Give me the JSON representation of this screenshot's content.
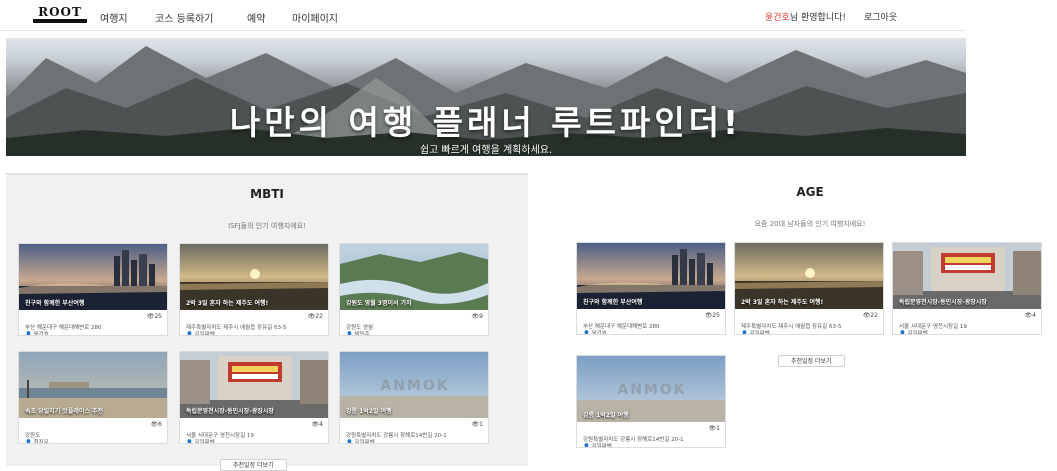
{
  "nav": {
    "logo": "ROOT",
    "logo_sub": "FINDER",
    "items": [
      "여행지",
      "코스 등록하기",
      "예약",
      "마이페이지"
    ],
    "user_name": "윤건호",
    "greeting_suffix": "님 환영합니다!",
    "logout": "로그아웃"
  },
  "hero": {
    "title": "나만의 여행 플래너 루트파인더!",
    "subtitle": "쉽고 빠르게 여행을 계획하세요."
  },
  "mbti": {
    "title": "MBTI",
    "subtitle": "ISFJ들의 인기 여행지에요!",
    "more": "추천일정 더보기",
    "cards": [
      {
        "caption": "친구와 함께한 부산여행",
        "views": "25",
        "address": "부산 해운대구 해운대해변로 280",
        "author": "윤건호",
        "scene": "city"
      },
      {
        "caption": "2박 3일 혼자 하는 제주도 여행!",
        "views": "22",
        "address": "제주특별자치도 제주시 애월읍 장유길 63-5",
        "author": "김일파벤",
        "scene": "sunset"
      },
      {
        "caption": "강원도 영월 3명이서 가자",
        "views": "9",
        "address": "강원도 영월",
        "author": "박민준",
        "scene": "river"
      },
      {
        "caption": "속초 당일치기 맛플레이스 추천",
        "views": "6",
        "address": "강원도",
        "author": "최지우",
        "scene": "beach"
      },
      {
        "caption": "독립문영천시장-동인시장-광장시장",
        "views": "4",
        "address": "서울 서대문구 영천시장길 19",
        "author": "김일파벤",
        "scene": "market"
      },
      {
        "caption": "강릉 1박2일 여행",
        "views": "1",
        "address": "강원특별자치도 강릉시 창해로14번길 20-1",
        "author": "김일파벤",
        "scene": "anmok"
      }
    ]
  },
  "age": {
    "title": "AGE",
    "subtitle": "요즘 20대 남자들의 인기 여행지에요!",
    "more": "추천일정 더보기",
    "cards": [
      {
        "caption": "친구와 함께한 부산여행",
        "views": "25",
        "address": "부산 해운대구 해운대해변로 280",
        "author": "윤건호",
        "scene": "city"
      },
      {
        "caption": "2박 3일 혼자 하는 제주도 여행!",
        "views": "22",
        "address": "제주특별자치도 제주시 애월읍 장유길 63-5",
        "author": "김일파벤",
        "scene": "sunset"
      },
      {
        "caption": "독립문영천시장-동인시장-광장시장",
        "views": "4",
        "address": "서울 서대문구 영천시장길 19",
        "author": "김일파벤",
        "scene": "market"
      },
      {
        "caption": "강릉 1박2일 여행",
        "views": "1",
        "address": "강원특별자치도 강릉시 창해로14번길 20-1",
        "author": "김일파벤",
        "scene": "anmok"
      }
    ]
  }
}
